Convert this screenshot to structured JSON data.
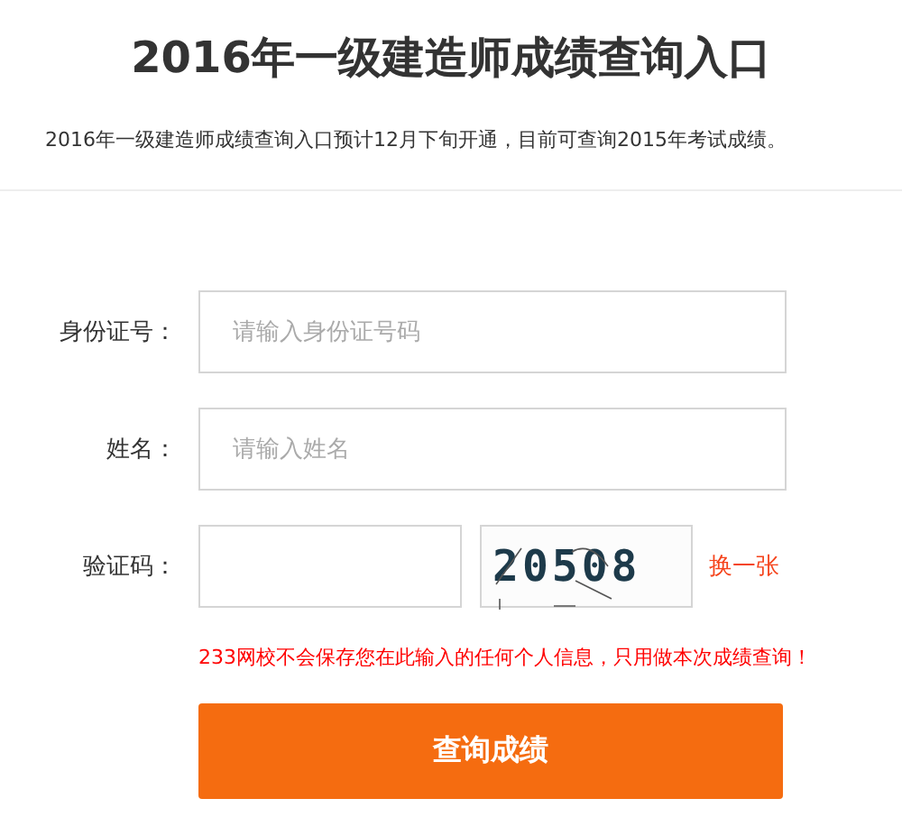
{
  "title": "2016年一级建造师成绩查询入口",
  "notice": "2016年一级建造师成绩查询入口预计12月下旬开通，目前可查询2015年考试成绩。",
  "fields": [
    {
      "kind": "text",
      "label": "身份证号：",
      "placeholder": "请输入身份证号码"
    },
    {
      "kind": "text",
      "label": "姓名：",
      "placeholder": "请输入姓名"
    },
    {
      "kind": "captcha",
      "label": "验证码：",
      "captcha_text": "20508",
      "refresh_link": "换一张"
    }
  ],
  "privacy_note": "233网校不会保存您在此输入的任何个人信息，只用做本次成绩查询！",
  "submit_button": "查询成绩"
}
